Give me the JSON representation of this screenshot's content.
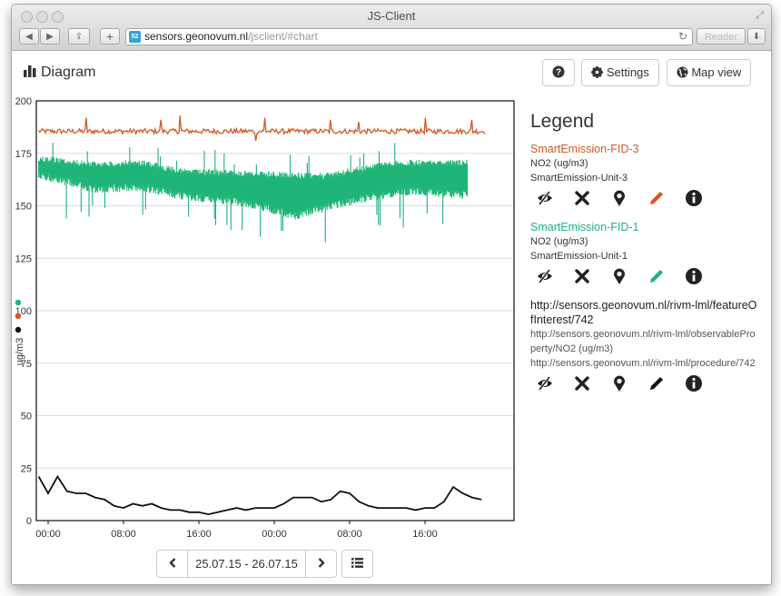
{
  "window": {
    "title": "JS-Client"
  },
  "browser": {
    "url_host": "sensors.geonovum.nl",
    "url_path": "/jsclient/#chart",
    "reader_label": "Reader",
    "favicon_text": "52"
  },
  "header": {
    "title": "Diagram",
    "help_icon": "question-circle-icon",
    "settings_label": "Settings",
    "mapview_label": "Map view"
  },
  "chart_data": {
    "type": "line",
    "ylabel": "ug/m3",
    "ylim": [
      0,
      200
    ],
    "yticks": [
      "0",
      "25",
      "50",
      "75",
      "100",
      "125",
      "150",
      "175",
      "200"
    ],
    "xticks": [
      "00:00",
      "08:00",
      "16:00",
      "00:00",
      "08:00",
      "16:00"
    ],
    "xrange_hours": [
      0,
      48
    ],
    "grid": true,
    "series": [
      {
        "name": "SmartEmission-FID-3",
        "color": "#d05a27",
        "style": "noisy",
        "base": 185.5,
        "noise": 1.2,
        "start_hour": -1,
        "end_hour": 46.5,
        "spikes": [
          [
            4,
            192
          ],
          [
            12,
            191
          ],
          [
            14,
            193
          ],
          [
            23,
            192
          ],
          [
            30,
            191
          ],
          [
            33,
            190
          ],
          [
            40,
            192
          ],
          [
            45,
            191
          ],
          [
            22,
            181
          ]
        ]
      },
      {
        "name": "SmartEmission-FID-1",
        "color": "#1fb578",
        "style": "band",
        "start_hour": -1,
        "end_hour": 44.5,
        "upper": [
          [
            -1,
            174
          ],
          [
            5,
            171
          ],
          [
            10,
            172
          ],
          [
            14,
            168
          ],
          [
            20,
            167
          ],
          [
            26,
            166
          ],
          [
            30,
            166
          ],
          [
            34,
            170
          ],
          [
            38,
            172
          ],
          [
            42,
            172
          ],
          [
            44.5,
            172
          ]
        ],
        "lower": [
          [
            -1,
            163
          ],
          [
            5,
            156
          ],
          [
            10,
            157
          ],
          [
            14,
            153
          ],
          [
            20,
            150
          ],
          [
            24,
            146
          ],
          [
            26,
            143
          ],
          [
            30,
            148
          ],
          [
            34,
            152
          ],
          [
            38,
            155
          ],
          [
            42,
            154
          ],
          [
            44.5,
            153
          ]
        ]
      },
      {
        "name": "http://sensors.geonovum.nl/rivm-lml/featureOfInterest/742",
        "color": "#111111",
        "style": "line",
        "points": [
          [
            -1,
            21
          ],
          [
            0,
            13
          ],
          [
            1,
            21
          ],
          [
            2,
            14
          ],
          [
            3,
            13
          ],
          [
            4,
            13
          ],
          [
            5,
            11
          ],
          [
            6,
            10
          ],
          [
            7,
            7
          ],
          [
            8,
            6
          ],
          [
            9,
            8
          ],
          [
            10,
            7
          ],
          [
            11,
            8
          ],
          [
            12,
            6
          ],
          [
            13,
            5
          ],
          [
            14,
            5
          ],
          [
            15,
            4
          ],
          [
            16,
            4
          ],
          [
            17,
            3
          ],
          [
            18,
            4
          ],
          [
            19,
            5
          ],
          [
            20,
            6
          ],
          [
            21,
            5
          ],
          [
            22,
            6
          ],
          [
            23,
            6
          ],
          [
            24,
            6
          ],
          [
            25,
            8
          ],
          [
            26,
            11
          ],
          [
            27,
            11
          ],
          [
            28,
            11
          ],
          [
            29,
            9
          ],
          [
            30,
            10
          ],
          [
            31,
            14
          ],
          [
            32,
            13
          ],
          [
            33,
            9
          ],
          [
            34,
            7
          ],
          [
            35,
            6
          ],
          [
            36,
            6
          ],
          [
            37,
            6
          ],
          [
            38,
            6
          ],
          [
            39,
            5
          ],
          [
            40,
            6
          ],
          [
            41,
            6
          ],
          [
            42,
            9
          ],
          [
            43,
            16
          ],
          [
            44,
            13
          ],
          [
            45,
            11
          ],
          [
            46,
            10
          ]
        ]
      }
    ]
  },
  "yaxis_dot_colors": [
    "#1fb578",
    "#d05a27",
    "#111111"
  ],
  "legend": {
    "title": "Legend",
    "items": [
      {
        "name": "SmartEmission-FID-3",
        "color": "#d05a27",
        "meta1": "NO2 (ug/m3)",
        "meta2": "SmartEmission-Unit-3",
        "pencil_color": "#d05a27"
      },
      {
        "name": "SmartEmission-FID-1",
        "color": "#1fb578",
        "meta1": "NO2 (ug/m3)",
        "meta2": "SmartEmission-Unit-1",
        "pencil_color": "#1fb578"
      },
      {
        "name": "http://sensors.geonovum.nl/rivm-lml/featureOfInterest/742",
        "color": "#222222",
        "meta1": "http://sensors.geonovum.nl/rivm-lml/observableProperty/NO2 (ug/m3)",
        "meta2": "http://sensors.geonovum.nl/rivm-lml/procedure/742",
        "pencil_color": "#111111"
      }
    ]
  },
  "pager": {
    "date_range": "25.07.15 - 26.07.15"
  }
}
